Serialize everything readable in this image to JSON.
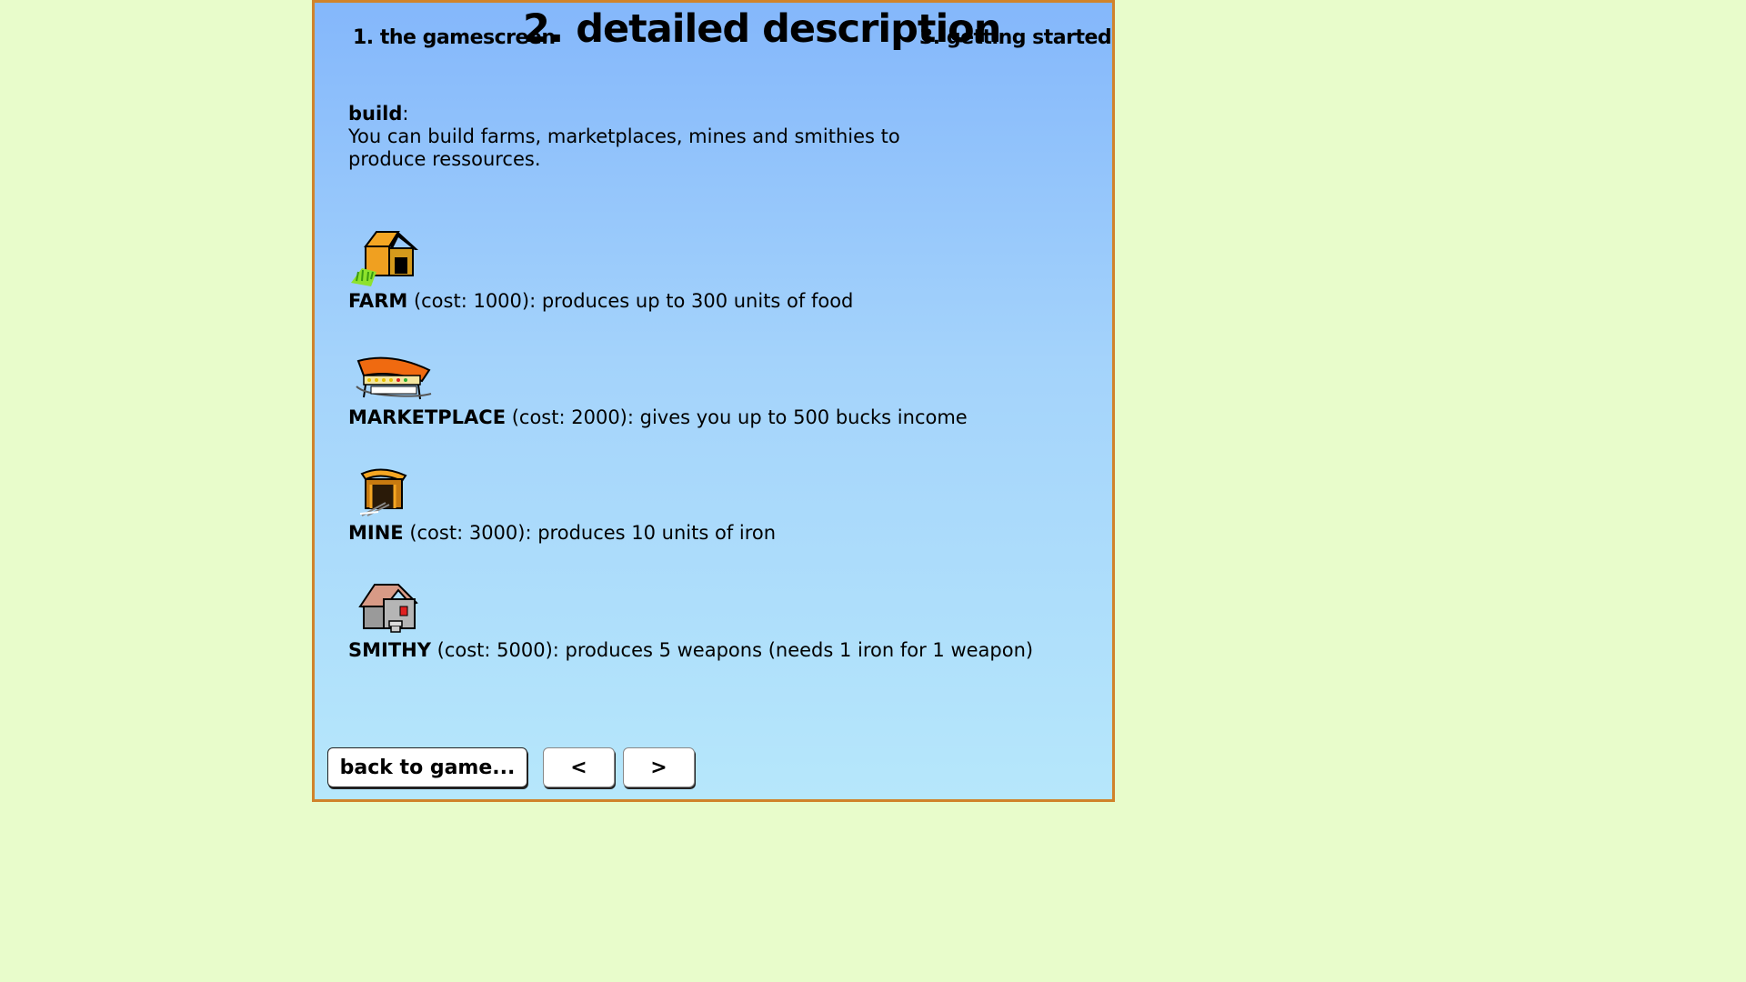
{
  "tabs": {
    "prev": "1. the gamescreen",
    "current": "2. detailed description",
    "next": "3. getting started"
  },
  "intro": {
    "heading": "build",
    "colon": ":",
    "text": "You can build farms, marketplaces, mines and smithies to produce ressources."
  },
  "buildings": [
    {
      "name": "FARM",
      "text": " (cost: 1000): produces up to 300 units of food",
      "icon": "farm-icon"
    },
    {
      "name": "MARKETPLACE",
      "text": " (cost: 2000): gives you up to 500 bucks income",
      "icon": "marketplace-icon"
    },
    {
      "name": "MINE",
      "text": " (cost: 3000): produces 10 units of iron",
      "icon": "mine-icon"
    },
    {
      "name": "SMITHY",
      "text": " (cost: 5000): produces 5 weapons (needs 1 iron for 1 weapon)",
      "icon": "smithy-icon"
    }
  ],
  "buttons": {
    "back": "back to game...",
    "prev": "<",
    "next": ">"
  },
  "colors": {
    "background": "#e8fccb",
    "border": "#d0832a",
    "panel_top": "#84b7fb",
    "panel_bottom": "#b6e7fb"
  }
}
